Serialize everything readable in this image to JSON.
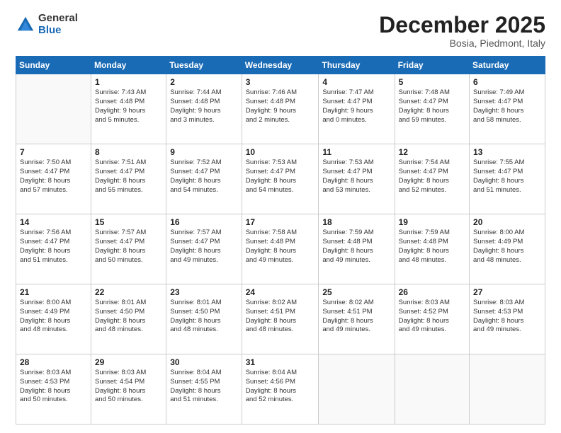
{
  "logo": {
    "general": "General",
    "blue": "Blue"
  },
  "title": "December 2025",
  "location": "Bosia, Piedmont, Italy",
  "days_of_week": [
    "Sunday",
    "Monday",
    "Tuesday",
    "Wednesday",
    "Thursday",
    "Friday",
    "Saturday"
  ],
  "weeks": [
    [
      {
        "day": "",
        "info": ""
      },
      {
        "day": "1",
        "info": "Sunrise: 7:43 AM\nSunset: 4:48 PM\nDaylight: 9 hours\nand 5 minutes."
      },
      {
        "day": "2",
        "info": "Sunrise: 7:44 AM\nSunset: 4:48 PM\nDaylight: 9 hours\nand 3 minutes."
      },
      {
        "day": "3",
        "info": "Sunrise: 7:46 AM\nSunset: 4:48 PM\nDaylight: 9 hours\nand 2 minutes."
      },
      {
        "day": "4",
        "info": "Sunrise: 7:47 AM\nSunset: 4:47 PM\nDaylight: 9 hours\nand 0 minutes."
      },
      {
        "day": "5",
        "info": "Sunrise: 7:48 AM\nSunset: 4:47 PM\nDaylight: 8 hours\nand 59 minutes."
      },
      {
        "day": "6",
        "info": "Sunrise: 7:49 AM\nSunset: 4:47 PM\nDaylight: 8 hours\nand 58 minutes."
      }
    ],
    [
      {
        "day": "7",
        "info": "Sunrise: 7:50 AM\nSunset: 4:47 PM\nDaylight: 8 hours\nand 57 minutes."
      },
      {
        "day": "8",
        "info": "Sunrise: 7:51 AM\nSunset: 4:47 PM\nDaylight: 8 hours\nand 55 minutes."
      },
      {
        "day": "9",
        "info": "Sunrise: 7:52 AM\nSunset: 4:47 PM\nDaylight: 8 hours\nand 54 minutes."
      },
      {
        "day": "10",
        "info": "Sunrise: 7:53 AM\nSunset: 4:47 PM\nDaylight: 8 hours\nand 54 minutes."
      },
      {
        "day": "11",
        "info": "Sunrise: 7:53 AM\nSunset: 4:47 PM\nDaylight: 8 hours\nand 53 minutes."
      },
      {
        "day": "12",
        "info": "Sunrise: 7:54 AM\nSunset: 4:47 PM\nDaylight: 8 hours\nand 52 minutes."
      },
      {
        "day": "13",
        "info": "Sunrise: 7:55 AM\nSunset: 4:47 PM\nDaylight: 8 hours\nand 51 minutes."
      }
    ],
    [
      {
        "day": "14",
        "info": "Sunrise: 7:56 AM\nSunset: 4:47 PM\nDaylight: 8 hours\nand 51 minutes."
      },
      {
        "day": "15",
        "info": "Sunrise: 7:57 AM\nSunset: 4:47 PM\nDaylight: 8 hours\nand 50 minutes."
      },
      {
        "day": "16",
        "info": "Sunrise: 7:57 AM\nSunset: 4:47 PM\nDaylight: 8 hours\nand 49 minutes."
      },
      {
        "day": "17",
        "info": "Sunrise: 7:58 AM\nSunset: 4:48 PM\nDaylight: 8 hours\nand 49 minutes."
      },
      {
        "day": "18",
        "info": "Sunrise: 7:59 AM\nSunset: 4:48 PM\nDaylight: 8 hours\nand 49 minutes."
      },
      {
        "day": "19",
        "info": "Sunrise: 7:59 AM\nSunset: 4:48 PM\nDaylight: 8 hours\nand 48 minutes."
      },
      {
        "day": "20",
        "info": "Sunrise: 8:00 AM\nSunset: 4:49 PM\nDaylight: 8 hours\nand 48 minutes."
      }
    ],
    [
      {
        "day": "21",
        "info": "Sunrise: 8:00 AM\nSunset: 4:49 PM\nDaylight: 8 hours\nand 48 minutes."
      },
      {
        "day": "22",
        "info": "Sunrise: 8:01 AM\nSunset: 4:50 PM\nDaylight: 8 hours\nand 48 minutes."
      },
      {
        "day": "23",
        "info": "Sunrise: 8:01 AM\nSunset: 4:50 PM\nDaylight: 8 hours\nand 48 minutes."
      },
      {
        "day": "24",
        "info": "Sunrise: 8:02 AM\nSunset: 4:51 PM\nDaylight: 8 hours\nand 48 minutes."
      },
      {
        "day": "25",
        "info": "Sunrise: 8:02 AM\nSunset: 4:51 PM\nDaylight: 8 hours\nand 49 minutes."
      },
      {
        "day": "26",
        "info": "Sunrise: 8:03 AM\nSunset: 4:52 PM\nDaylight: 8 hours\nand 49 minutes."
      },
      {
        "day": "27",
        "info": "Sunrise: 8:03 AM\nSunset: 4:53 PM\nDaylight: 8 hours\nand 49 minutes."
      }
    ],
    [
      {
        "day": "28",
        "info": "Sunrise: 8:03 AM\nSunset: 4:53 PM\nDaylight: 8 hours\nand 50 minutes."
      },
      {
        "day": "29",
        "info": "Sunrise: 8:03 AM\nSunset: 4:54 PM\nDaylight: 8 hours\nand 50 minutes."
      },
      {
        "day": "30",
        "info": "Sunrise: 8:04 AM\nSunset: 4:55 PM\nDaylight: 8 hours\nand 51 minutes."
      },
      {
        "day": "31",
        "info": "Sunrise: 8:04 AM\nSunset: 4:56 PM\nDaylight: 8 hours\nand 52 minutes."
      },
      {
        "day": "",
        "info": ""
      },
      {
        "day": "",
        "info": ""
      },
      {
        "day": "",
        "info": ""
      }
    ]
  ]
}
